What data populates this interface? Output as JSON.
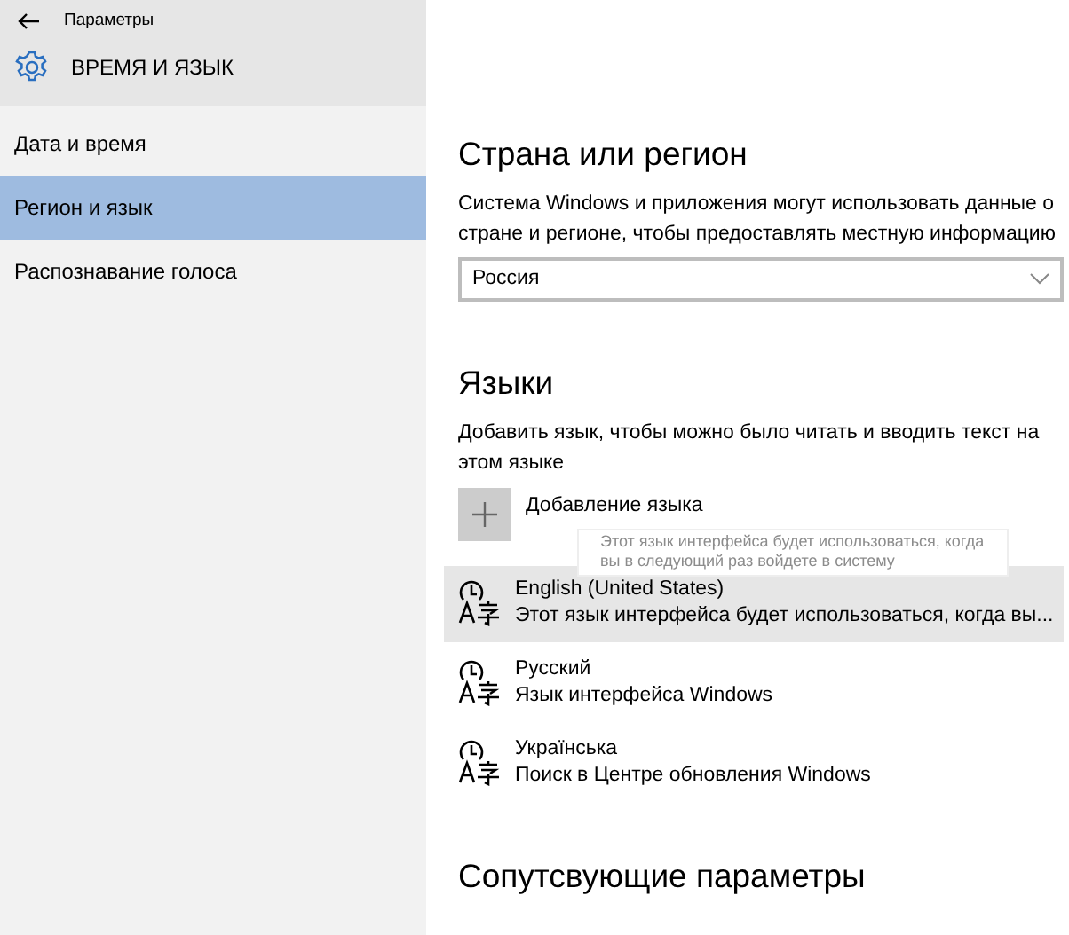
{
  "window": {
    "title": "Параметры"
  },
  "section_title": "ВРЕМЯ И ЯЗЫК",
  "sidebar": {
    "items": [
      {
        "label": "Дата и время",
        "selected": false
      },
      {
        "label": "Регион и язык",
        "selected": true
      },
      {
        "label": "Распознавание голоса",
        "selected": false
      }
    ]
  },
  "region": {
    "heading": "Страна или регион",
    "description": "Система Windows и приложения могут использовать данные о стране и регионе, чтобы предоставлять местную информацию",
    "dropdown": {
      "value": "Россия"
    }
  },
  "languages": {
    "heading": "Языки",
    "description": "Добавить язык, чтобы можно было читать и вводить текст на этом языке",
    "add_button": "Добавление языка",
    "tooltip": "Этот язык интерфейса будет использоваться, когда вы в следующий раз войдете в систему",
    "items": [
      {
        "name": "English (United States)",
        "status": "Этот язык интерфейса будет использоваться, когда вы...",
        "selected": true
      },
      {
        "name": "Русский",
        "status": "Язык интерфейса Windows",
        "selected": false
      },
      {
        "name": "Українська",
        "status": "Поиск в Центре обновления Windows",
        "selected": false
      }
    ]
  },
  "related": {
    "heading": "Сопутсвующие параметры"
  }
}
